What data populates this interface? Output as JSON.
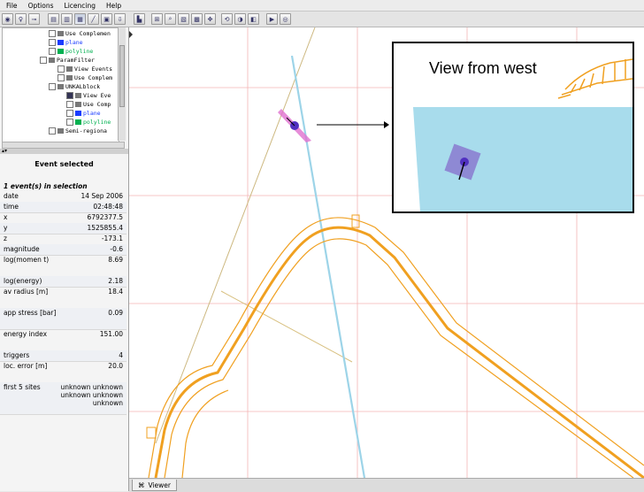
{
  "menu": [
    "File",
    "Options",
    "Licencing",
    "Help"
  ],
  "tree": {
    "items": [
      {
        "label": "Use Complemen",
        "checked": false,
        "icon": "x-mark-icon",
        "indent": 56,
        "color": "#000"
      },
      {
        "label": "plane",
        "checked": false,
        "icon": "plane-icon",
        "indent": 56,
        "color": "#1a3cff"
      },
      {
        "label": "polyline",
        "checked": false,
        "icon": "polyline-icon",
        "indent": 56,
        "color": "#00b050"
      },
      {
        "label": "ParamFilter",
        "checked": false,
        "icon": "filter-icon",
        "indent": 46,
        "color": "#000"
      },
      {
        "label": "View Events",
        "checked": false,
        "icon": "eye-icon",
        "indent": 66,
        "color": "#000"
      },
      {
        "label": "Use Complem",
        "checked": false,
        "icon": "x-mark-icon",
        "indent": 66,
        "color": "#000"
      },
      {
        "label": "UNKALblock",
        "checked": false,
        "icon": "block-icon",
        "indent": 56,
        "color": "#000"
      },
      {
        "label": "View Eve",
        "checked": true,
        "icon": "eye-icon",
        "indent": 76,
        "color": "#000"
      },
      {
        "label": "Use Comp",
        "checked": false,
        "icon": "x-mark-icon",
        "indent": 76,
        "color": "#000"
      },
      {
        "label": "plane",
        "checked": false,
        "icon": "plane-icon",
        "indent": 76,
        "color": "#1a3cff"
      },
      {
        "label": "polyline",
        "checked": false,
        "icon": "polyline-icon",
        "indent": 76,
        "color": "#00b050"
      },
      {
        "label": "Semi-regiona",
        "checked": false,
        "icon": "block-icon",
        "indent": 56,
        "color": "#000"
      }
    ]
  },
  "event_panel": {
    "title": "Event selected",
    "count": "1 event(s) in selection",
    "properties": [
      {
        "key": "date",
        "value": "14 Sep 2006"
      },
      {
        "key": "time",
        "value": "02:48:48"
      },
      {
        "key": "x",
        "value": "6792377.5"
      },
      {
        "key": "y",
        "value": "1525855.4"
      },
      {
        "key": "z",
        "value": "-173.1"
      },
      {
        "key": "magnitude",
        "value": "-0.6"
      },
      {
        "key": "log(momen t)",
        "value": "8.69"
      },
      {
        "key": "log(energy)",
        "value": "2.18"
      },
      {
        "key": "av radius [m]",
        "value": "18.4"
      },
      {
        "key": "app stress [bar]",
        "value": "0.09"
      },
      {
        "key": "energy index",
        "value": "151.00"
      },
      {
        "key": "triggers",
        "value": "4"
      },
      {
        "key": "loc. error [m]",
        "value": "20.0"
      },
      {
        "key": "first 5 sites",
        "value": "unknown unknown unknown unknown unknown"
      }
    ]
  },
  "viewer": {
    "tab_label": "Viewer",
    "inset_title": "View from west"
  },
  "colors": {
    "tunnel": "#f0a020",
    "grid": "#f4b4b4",
    "plane": "#a8dcec",
    "event": "#5030c0",
    "event_plane": "#e070d0",
    "square": "#8a7ad0"
  }
}
